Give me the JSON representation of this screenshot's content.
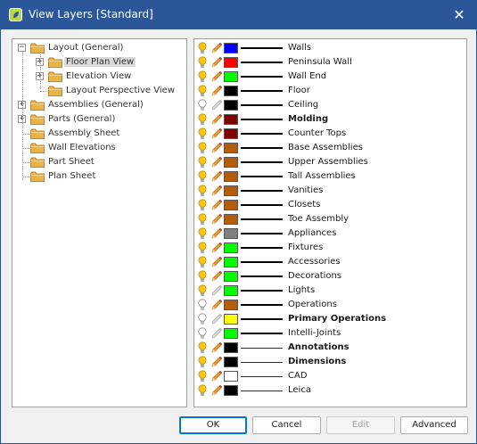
{
  "window": {
    "title": "View Layers [Standard]",
    "close_glyph": "✕"
  },
  "colors": {
    "titlebar": "#2b579a",
    "accent": "#0078d4"
  },
  "tree": [
    {
      "label": "Layout (General)",
      "level": 0,
      "expander": "−",
      "selected": false
    },
    {
      "label": "Floor Plan View",
      "level": 1,
      "expander": "+",
      "selected": true
    },
    {
      "label": "Elevation View",
      "level": 1,
      "expander": "+",
      "selected": false
    },
    {
      "label": "Layout Perspective View",
      "level": 1,
      "expander": "",
      "selected": false
    },
    {
      "label": "Assemblies (General)",
      "level": 0,
      "expander": "+",
      "selected": false
    },
    {
      "label": "Parts (General)",
      "level": 0,
      "expander": "+",
      "selected": false
    },
    {
      "label": "Assembly Sheet",
      "level": 0,
      "expander": "",
      "selected": false
    },
    {
      "label": "Wall Elevations",
      "level": 0,
      "expander": "",
      "selected": false
    },
    {
      "label": "Part Sheet",
      "level": 0,
      "expander": "",
      "selected": false
    },
    {
      "label": "Plan Sheet",
      "level": 0,
      "expander": "",
      "selected": false
    }
  ],
  "layers": [
    {
      "name": "Walls",
      "color": "#0000ff",
      "visible": true,
      "editable": true,
      "bold": false,
      "thin": false
    },
    {
      "name": "Peninsula Wall",
      "color": "#ff0000",
      "visible": true,
      "editable": true,
      "bold": false,
      "thin": false
    },
    {
      "name": "Wall End",
      "color": "#00ff00",
      "visible": true,
      "editable": true,
      "bold": false,
      "thin": false
    },
    {
      "name": "Floor",
      "color": "#000000",
      "visible": true,
      "editable": true,
      "bold": false,
      "thin": false
    },
    {
      "name": "Ceiling",
      "color": "#000000",
      "visible": false,
      "editable": false,
      "bold": false,
      "thin": false
    },
    {
      "name": "Molding",
      "color": "#800000",
      "visible": true,
      "editable": true,
      "bold": true,
      "thin": false
    },
    {
      "name": "Counter Tops",
      "color": "#800000",
      "visible": true,
      "editable": true,
      "bold": false,
      "thin": false
    },
    {
      "name": "Base Assemblies",
      "color": "#b45f06",
      "visible": true,
      "editable": true,
      "bold": false,
      "thin": false
    },
    {
      "name": "Upper Assemblies",
      "color": "#b45f06",
      "visible": true,
      "editable": true,
      "bold": false,
      "thin": false
    },
    {
      "name": "Tall Assemblies",
      "color": "#b45f06",
      "visible": true,
      "editable": true,
      "bold": false,
      "thin": false
    },
    {
      "name": "Vanities",
      "color": "#b45f06",
      "visible": true,
      "editable": true,
      "bold": false,
      "thin": false
    },
    {
      "name": "Closets",
      "color": "#b45f06",
      "visible": true,
      "editable": true,
      "bold": false,
      "thin": false
    },
    {
      "name": "Toe Assembly",
      "color": "#b45f06",
      "visible": true,
      "editable": true,
      "bold": false,
      "thin": false
    },
    {
      "name": "Appliances",
      "color": "#808080",
      "visible": true,
      "editable": true,
      "bold": false,
      "thin": false
    },
    {
      "name": "Fixtures",
      "color": "#00ff00",
      "visible": true,
      "editable": true,
      "bold": false,
      "thin": false
    },
    {
      "name": "Accessories",
      "color": "#00ff00",
      "visible": true,
      "editable": true,
      "bold": false,
      "thin": false
    },
    {
      "name": "Decorations",
      "color": "#00ff00",
      "visible": true,
      "editable": true,
      "bold": false,
      "thin": false
    },
    {
      "name": "Lights",
      "color": "#00ff00",
      "visible": true,
      "editable": false,
      "bold": false,
      "thin": false
    },
    {
      "name": "Operations",
      "color": "#b45f06",
      "visible": false,
      "editable": true,
      "bold": false,
      "thin": false
    },
    {
      "name": "Primary Operations",
      "color": "#ffff00",
      "visible": false,
      "editable": false,
      "bold": true,
      "thin": false
    },
    {
      "name": "Intelli-Joints",
      "color": "#00ff00",
      "visible": false,
      "editable": false,
      "bold": false,
      "thin": false
    },
    {
      "name": "Annotations",
      "color": "#000000",
      "visible": true,
      "editable": true,
      "bold": true,
      "thin": true
    },
    {
      "name": "Dimensions",
      "color": "#000000",
      "visible": true,
      "editable": true,
      "bold": true,
      "thin": true
    },
    {
      "name": "CAD",
      "color": "#ffffff",
      "visible": true,
      "editable": true,
      "bold": false,
      "thin": true
    },
    {
      "name": "Leica",
      "color": "#000000",
      "visible": true,
      "editable": true,
      "bold": false,
      "thin": true
    }
  ],
  "buttons": {
    "ok": "OK",
    "cancel": "Cancel",
    "edit": "Edit",
    "advanced": "Advanced"
  }
}
